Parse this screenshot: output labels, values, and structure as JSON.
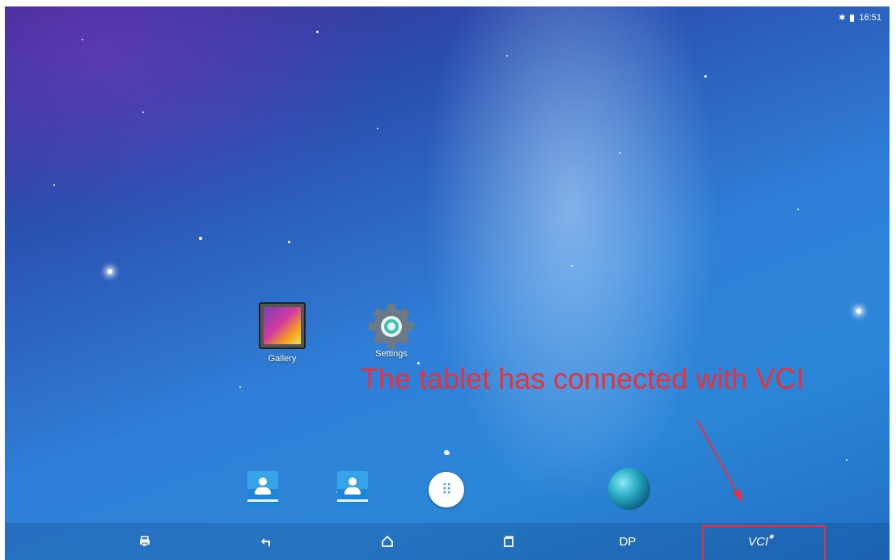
{
  "status_bar": {
    "time": "16:51",
    "bluetooth_icon": "bluetooth-icon",
    "battery_icon": "battery-icon"
  },
  "apps": [
    {
      "label": "Gallery",
      "icon": "gallery-icon"
    },
    {
      "label": "Settings",
      "icon": "settings-gear-icon"
    }
  ],
  "annotation": {
    "text": "The tablet has connected with VCI",
    "color": "#e8313a"
  },
  "dock": [
    {
      "icon": "contacts-icon"
    },
    {
      "icon": "contacts-icon"
    },
    {
      "icon": "all-apps-icon"
    },
    {
      "icon": "browser-globe-icon"
    }
  ],
  "nav_bar": {
    "print_icon": "printer-icon",
    "back_icon": "back-icon",
    "home_icon": "home-icon",
    "recents_icon": "recents-icon",
    "dp_label": "DP",
    "vci_label": "VCI"
  }
}
